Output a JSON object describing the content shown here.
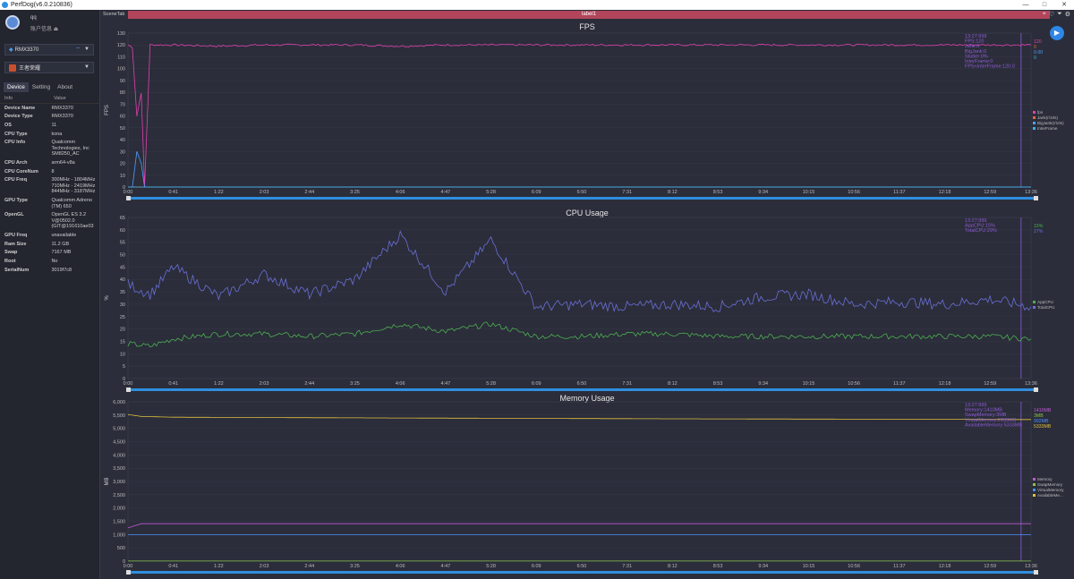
{
  "window": {
    "title": "PerfDog(v6.0.210836)",
    "controls": [
      "—",
      "□",
      "✕"
    ]
  },
  "user": {
    "name": "qq",
    "subtitle": "账户信息 ⏏"
  },
  "device_select": {
    "value": "RMX3370"
  },
  "app_select": {
    "value": "王者荣耀"
  },
  "tabs": [
    "Device",
    "Setting",
    "About"
  ],
  "info": {
    "headers": [
      "Info",
      "Value"
    ],
    "rows": [
      [
        "Device Name",
        "RMX3370"
      ],
      [
        "Device Type",
        "RMX3370"
      ],
      [
        "OS",
        "11"
      ],
      [
        "CPU Type",
        "kona"
      ],
      [
        "CPU Info",
        "Qualcomm Technologies, Inc SM8250_AC"
      ],
      [
        "CPU Arch",
        "arm64-v8a"
      ],
      [
        "CPU CoreNum",
        "8"
      ],
      [
        "CPU Freq",
        "300MHz - 1804MHz 710MHz - 2419MHz 844MHz - 3187MHz"
      ],
      [
        "GPU Type",
        "Qualcomm Adreno (TM) 650"
      ],
      [
        "OpenGL",
        "OpenGL ES 3.2 V@0502.0 (GIT@191610ae03"
      ],
      [
        "GPU Freq",
        "unavailable"
      ],
      [
        "Ram Size",
        "11.2 GB"
      ],
      [
        "Swap",
        "7167 MB"
      ],
      [
        "Root",
        "No"
      ],
      [
        "SerialNum",
        "3019f7c8"
      ]
    ]
  },
  "topbar": {
    "scenetab": "SceneTab",
    "label": "label1"
  },
  "x_ticks": [
    "0:00",
    "0:41",
    "1:22",
    "2:03",
    "2:44",
    "3:25",
    "4:06",
    "4:47",
    "5:28",
    "6:09",
    "6:50",
    "7:31",
    "8:12",
    "8:53",
    "9:34",
    "10:15",
    "10:56",
    "11:37",
    "12:18",
    "12:59",
    "13:36"
  ],
  "charts": {
    "fps": {
      "title": "FPS",
      "ylabel": "FPS",
      "yticks": [
        "0",
        "10",
        "20",
        "30",
        "40",
        "50",
        "60",
        "70",
        "80",
        "90",
        "100",
        "110",
        "120",
        "130"
      ],
      "readout": [
        "13:27:999",
        "FPS:120",
        "Jank:0",
        "BigJank:0",
        "Stutter:0%",
        "InterFrame:0",
        "FPS<interFrame:120.0"
      ],
      "right_values": [
        "120",
        "0",
        "0.00",
        "0"
      ],
      "legend": [
        "fps",
        "Jank(r/10s)",
        "BigJank(r/10s)",
        "InterFrame"
      ],
      "colors": [
        "#e040b0",
        "#e06a3a",
        "#4ea0ff",
        "#3fb3e8"
      ]
    },
    "cpu": {
      "title": "CPU Usage",
      "ylabel": "%",
      "yticks": [
        "0",
        "5",
        "10",
        "15",
        "20",
        "25",
        "30",
        "35",
        "40",
        "45",
        "50",
        "55",
        "60",
        "65"
      ],
      "readout": [
        "13:27:999",
        "AppCPU:15%",
        "TotalCPU:29%"
      ],
      "right_values": [
        "15%",
        "27%"
      ],
      "legend": [
        "AppCPU",
        "TotalCPU"
      ],
      "colors": [
        "#4caf50",
        "#6a6fd6"
      ]
    },
    "memory": {
      "title": "Memory Usage",
      "ylabel": "MB",
      "yticks": [
        "0",
        "500",
        "1,000",
        "1,500",
        "2,000",
        "2,500",
        "3,000",
        "3,500",
        "4,000",
        "4,500",
        "5,000",
        "5,500",
        "6,000"
      ],
      "readout": [
        "13:27:999",
        "Memory:1410MB",
        "SwapMemory:3MB",
        "VirtualMemory:2955MB",
        "AvailableMemory:5333MB"
      ],
      "right_values": [
        "1410MB",
        "3MB",
        "992MB",
        "5333MB"
      ],
      "legend": [
        "Memory",
        "SwapMemory",
        "VirtualMemory",
        "AvailableMe..."
      ],
      "colors": [
        "#c05ad6",
        "#8bc34a",
        "#4e8dff",
        "#e0c040"
      ]
    }
  },
  "chart_data": [
    {
      "type": "line",
      "title": "FPS",
      "ylabel": "FPS",
      "ylim": [
        0,
        130
      ],
      "xlim": [
        "0:00",
        "13:36"
      ],
      "series": [
        {
          "name": "fps",
          "x": [
            "0:00",
            "0:04",
            "0:08",
            "0:12",
            "0:15",
            "0:20",
            "0:41",
            "1:22",
            "2:03",
            "2:44",
            "3:25",
            "4:06",
            "4:47",
            "5:28",
            "6:09",
            "6:50",
            "7:31",
            "8:12",
            "8:53",
            "9:34",
            "10:15",
            "10:56",
            "11:37",
            "12:18",
            "12:59",
            "13:36"
          ],
          "values": [
            120,
            118,
            60,
            80,
            0,
            120,
            120,
            119,
            120,
            120,
            120,
            119,
            120,
            120,
            120,
            120,
            120,
            120,
            120,
            120,
            120,
            120,
            120,
            120,
            120,
            120
          ]
        },
        {
          "name": "Jank(r/10s)",
          "values": [
            0,
            0,
            0,
            0,
            0,
            0,
            0,
            0,
            0,
            0,
            0,
            0,
            0,
            0,
            0,
            0,
            0,
            0,
            0,
            0,
            0,
            0,
            0,
            0,
            0,
            0
          ]
        },
        {
          "name": "BigJank(r/10s)",
          "values": [
            0,
            0,
            30,
            20,
            0,
            0,
            0,
            0,
            0,
            0,
            0,
            0,
            0,
            0,
            0,
            0,
            0,
            0,
            0,
            0,
            0,
            0,
            0,
            0,
            0,
            0
          ]
        },
        {
          "name": "InterFrame",
          "values": [
            0,
            0,
            0,
            0,
            0,
            0,
            0,
            0,
            0,
            0,
            0,
            0,
            0,
            0,
            0,
            0,
            0,
            0,
            0,
            0,
            0,
            0,
            0,
            0,
            0,
            0
          ]
        }
      ]
    },
    {
      "type": "line",
      "title": "CPU Usage",
      "ylabel": "%",
      "ylim": [
        0,
        65
      ],
      "xlim": [
        "0:00",
        "13:36"
      ],
      "series": [
        {
          "name": "AppCPU",
          "x": [
            "0:00",
            "0:20",
            "0:41",
            "1:22",
            "2:03",
            "2:44",
            "3:25",
            "4:06",
            "4:47",
            "5:28",
            "6:09",
            "6:50",
            "7:31",
            "8:12",
            "8:53",
            "9:34",
            "10:15",
            "10:56",
            "11:37",
            "12:18",
            "12:59",
            "13:36"
          ],
          "values": [
            14,
            13,
            16,
            18,
            18,
            17,
            18,
            22,
            19,
            22,
            17,
            17,
            18,
            18,
            17,
            17,
            17,
            17,
            17,
            17,
            17,
            16
          ]
        },
        {
          "name": "TotalCPU",
          "x": [
            "0:00",
            "0:20",
            "0:41",
            "1:22",
            "2:03",
            "2:44",
            "3:25",
            "4:06",
            "4:47",
            "5:28",
            "6:09",
            "6:50",
            "7:31",
            "8:12",
            "8:53",
            "9:34",
            "10:15",
            "10:56",
            "11:37",
            "12:18",
            "12:59",
            "13:36"
          ],
          "values": [
            38,
            34,
            45,
            33,
            42,
            34,
            40,
            58,
            35,
            56,
            29,
            30,
            29,
            30,
            29,
            33,
            34,
            30,
            31,
            30,
            32,
            29
          ]
        }
      ]
    },
    {
      "type": "line",
      "title": "Memory Usage",
      "ylabel": "MB",
      "ylim": [
        0,
        6000
      ],
      "xlim": [
        "0:00",
        "13:36"
      ],
      "series": [
        {
          "name": "Memory",
          "x": [
            "0:00",
            "0:12",
            "0:41",
            "4:06",
            "8:12",
            "13:36"
          ],
          "values": [
            1250,
            1410,
            1410,
            1410,
            1410,
            1410
          ]
        },
        {
          "name": "SwapMemory",
          "x": [
            "0:00",
            "13:36"
          ],
          "values": [
            3,
            3
          ]
        },
        {
          "name": "VirtualMemory",
          "x": [
            "0:00",
            "13:36"
          ],
          "values": [
            992,
            992
          ]
        },
        {
          "name": "AvailableMemory",
          "x": [
            "0:00",
            "0:12",
            "0:41",
            "4:06",
            "8:12",
            "13:36"
          ],
          "values": [
            5520,
            5450,
            5420,
            5390,
            5360,
            5333
          ]
        }
      ]
    }
  ]
}
